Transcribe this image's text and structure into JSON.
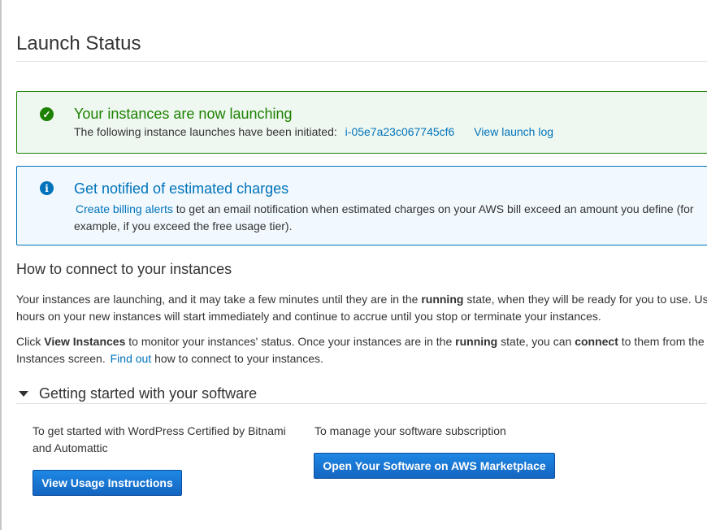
{
  "page": {
    "title": "Launch Status"
  },
  "success_alert": {
    "heading": "Your instances are now launching",
    "body_prefix": "The following instance launches have been initiated:",
    "instance_id": "i-05e7a23c067745cf6",
    "launch_log_link": "View launch log",
    "icon": "check-circle-icon"
  },
  "info_alert": {
    "heading": "Get notified of estimated charges",
    "billing_link": "Create billing alerts",
    "body_rest": "to get an email notification when estimated charges on your AWS bill exceed an amount you define (for example, if you exceed the free usage tier).",
    "icon": "info-circle-icon"
  },
  "connect": {
    "title": "How to connect to your instances",
    "p1_a": "Your instances are launching, and it may take a few minutes until they are in the",
    "p1_bold": "running",
    "p1_b": "state, when they will be ready for you to use. Us",
    "p1_line2": "hours on your new instances will start immediately and continue to accrue until you stop or terminate your instances.",
    "p2_a": "Click",
    "p2_bold1": "View Instances",
    "p2_b": "to monitor your instances' status. Once your instances are in the",
    "p2_bold2": "running",
    "p2_c": "state, you can",
    "p2_bold3": "connect",
    "p2_d": "to them from the",
    "p2_line2_a": "Instances screen.",
    "p2_link": "Find out",
    "p2_line2_b": "how to connect to your instances."
  },
  "software": {
    "title": "Getting started with your software",
    "left_text": "To get started with WordPress Certified by Bitnami and Automattic",
    "left_button": "View Usage Instructions",
    "right_text": "To manage your software subscription",
    "right_button": "Open Your Software on AWS Marketplace"
  },
  "colors": {
    "success": "#1d8102",
    "info": "#0073bb",
    "button": "#1665c0"
  }
}
